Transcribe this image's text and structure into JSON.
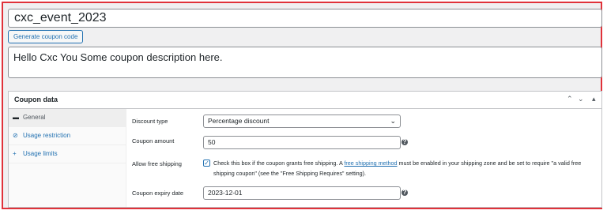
{
  "coupon": {
    "code": "cxc_event_2023",
    "generate_button": "Generate coupon code",
    "description": "Hello Cxc You Some coupon description here."
  },
  "panel": {
    "title": "Coupon data",
    "controls": [
      "▲",
      "▼",
      "▴"
    ]
  },
  "tabs": [
    {
      "label": "General",
      "icon": "ticket-icon",
      "active": true
    },
    {
      "label": "Usage restriction",
      "icon": "ban-icon",
      "active": false
    },
    {
      "label": "Usage limits",
      "icon": "plus-cross-icon",
      "active": false
    }
  ],
  "fields": {
    "discount_type": {
      "label": "Discount type",
      "value": "Percentage discount"
    },
    "coupon_amount": {
      "label": "Coupon amount",
      "value": "50"
    },
    "free_shipping": {
      "label": "Allow free shipping",
      "checked": true,
      "text_before": "Check this box if the coupon grants free shipping. A ",
      "link_text": "free shipping method",
      "text_after": " must be enabled in your shipping zone and be set to require \"a valid free shipping coupon\" (see the \"Free Shipping Requires\" setting)."
    },
    "expiry_date": {
      "label": "Coupon expiry date",
      "value": "2023-12-01"
    }
  },
  "colors": {
    "frame": "#e0323a",
    "link": "#2271b1"
  }
}
